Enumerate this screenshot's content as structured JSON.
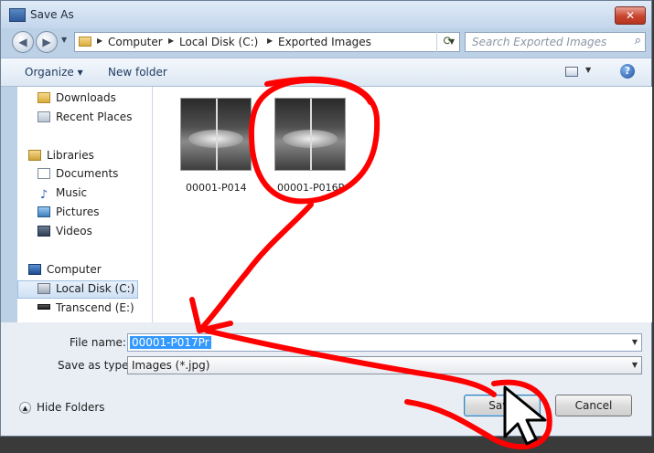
{
  "window": {
    "title": "Save As",
    "close_glyph": "✕",
    "icon": "app-icon"
  },
  "address_bar": {
    "back_glyph": "◀",
    "forward_glyph": "▶",
    "breadcrumbs": [
      "Computer",
      "Local Disk (C:)",
      "Exported Images"
    ],
    "search_placeholder": "Search Exported Images"
  },
  "toolbar": {
    "organize_label": "Organize ▾",
    "new_folder_label": "New folder",
    "help_glyph": "?"
  },
  "nav_pane": {
    "items": [
      {
        "label": "Downloads",
        "icon": "downloads-folder-icon"
      },
      {
        "label": "Recent Places",
        "icon": "recent-places-icon"
      },
      {
        "label": "Libraries",
        "icon": "libraries-icon"
      },
      {
        "label": "Documents",
        "icon": "documents-icon"
      },
      {
        "label": "Music",
        "icon": "music-icon"
      },
      {
        "label": "Pictures",
        "icon": "pictures-icon"
      },
      {
        "label": "Videos",
        "icon": "videos-icon"
      },
      {
        "label": "Computer",
        "icon": "computer-icon"
      },
      {
        "label": "Local Disk (C:)",
        "icon": "local-disk-icon"
      },
      {
        "label": "Transcend (E:)",
        "icon": "usb-drive-icon"
      }
    ],
    "selected_item": "Local Disk (C:)"
  },
  "files": [
    {
      "name": "00001-P014",
      "icon": "xray-thumbnail"
    },
    {
      "name": "00001-P016Pr",
      "icon": "xray-thumbnail"
    }
  ],
  "form": {
    "file_name_label": "File name:",
    "file_name_value": "00001-P017Pr",
    "save_as_type_label": "Save as type:",
    "save_as_type_value": "Images (*.jpg)"
  },
  "footer": {
    "hide_folders_label": "Hide Folders",
    "save_label": "Save",
    "cancel_label": "Cancel"
  },
  "colors": {
    "annotation": "#ff0000",
    "selection": "#3399ff",
    "close_button": "#c9442e"
  }
}
